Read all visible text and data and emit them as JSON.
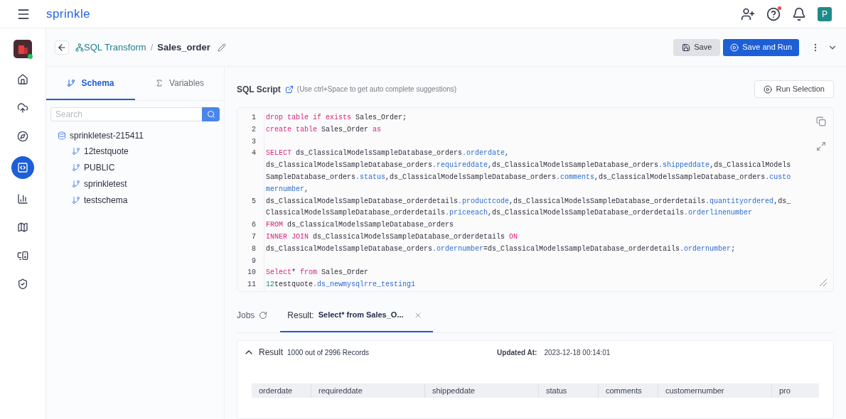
{
  "app": {
    "logo": "sprinkle",
    "avatar": "P",
    "help_notification": true
  },
  "rail": [
    {
      "selected": false
    },
    {
      "selected": false
    },
    {
      "selected": false
    },
    {
      "selected": true
    },
    {
      "selected": false
    },
    {
      "selected": false
    },
    {
      "selected": false
    },
    {
      "selected": false
    }
  ],
  "breadcrumb": {
    "parent": "SQL Transform",
    "separator": "/",
    "current": "Sales_order"
  },
  "actions": {
    "save": "Save",
    "save_and_run": "Save and Run"
  },
  "side_tabs": [
    {
      "label": "Schema",
      "selected": true
    },
    {
      "label": "Variables",
      "selected": false
    }
  ],
  "search": {
    "placeholder": "Search"
  },
  "schema_tree": [
    {
      "label": "sprinkletest-215411",
      "children": [
        {
          "label": "12testquote"
        },
        {
          "label": "PUBLIC"
        },
        {
          "label": "sprinkletest"
        },
        {
          "label": "testschema"
        }
      ]
    }
  ],
  "editor": {
    "title": "SQL Script",
    "hint": "(Use ctrl+Space to get auto complete suggestions)",
    "run_selection": "Run Selection",
    "lines": [
      {
        "number": "1",
        "tokens": [
          {
            "kind": "kw",
            "text": "drop table if exists"
          },
          {
            "kind": "plain",
            "text": " Sales_Order;"
          }
        ]
      },
      {
        "number": "2",
        "tokens": [
          {
            "kind": "kw",
            "text": "create table"
          },
          {
            "kind": "plain",
            "text": " Sales_Order "
          },
          {
            "kind": "kw",
            "text": "as"
          }
        ]
      },
      {
        "number": "3"
      },
      {
        "number": "4",
        "tokens": [
          {
            "kind": "kw",
            "text": "SELECT"
          },
          {
            "kind": "plain",
            "text": " ds_ClassicalModelsSampleDatabase_orders"
          },
          {
            "kind": "prop",
            "text": ".orderdate"
          },
          {
            "kind": "plain",
            "text": ", ds_ClassicalModelsSampleDatabase_orders"
          },
          {
            "kind": "prop",
            "text": ".requireddate"
          },
          {
            "kind": "plain",
            "text": ",ds_ClassicalModelsSampleDatabase_orders"
          },
          {
            "kind": "prop",
            "text": ".shippeddate"
          },
          {
            "kind": "plain",
            "text": ",ds_ClassicalModelsSampleDatabase_orders"
          },
          {
            "kind": "prop",
            "text": ".status"
          },
          {
            "kind": "plain",
            "text": ",ds_ClassicalModelsSampleDatabase_orders"
          },
          {
            "kind": "prop",
            "text": ".comments"
          },
          {
            "kind": "plain",
            "text": ",ds_ClassicalModelsSampleDatabase_orders"
          },
          {
            "kind": "prop",
            "text": ".customernumber"
          },
          {
            "kind": "plain",
            "text": ","
          }
        ]
      },
      {
        "number": "5",
        "tokens": [
          {
            "kind": "plain",
            "text": "ds_ClassicalModelsSampleDatabase_orderdetails"
          },
          {
            "kind": "prop",
            "text": ".productcode"
          },
          {
            "kind": "plain",
            "text": ",ds_ClassicalModelsSampleDatabase_orderdetails"
          },
          {
            "kind": "prop",
            "text": ".quantityordered"
          },
          {
            "kind": "plain",
            "text": ",ds_ClassicalModelsSampleDatabase_orderdetails"
          },
          {
            "kind": "prop",
            "text": ".priceeach"
          },
          {
            "kind": "plain",
            "text": ",ds_ClassicalModelsSampleDatabase_orderdetails"
          },
          {
            "kind": "prop",
            "text": ".orderlinenumber"
          }
        ]
      },
      {
        "number": "6",
        "tokens": [
          {
            "kind": "kw",
            "text": "FROM"
          },
          {
            "kind": "plain",
            "text": " ds_ClassicalModelsSampleDatabase_orders"
          }
        ]
      },
      {
        "number": "7",
        "tokens": [
          {
            "kind": "kw",
            "text": "INNER JOIN"
          },
          {
            "kind": "plain",
            "text": " ds_ClassicalModelsSampleDatabase_orderdetails "
          },
          {
            "kind": "kw",
            "text": "ON"
          }
        ]
      },
      {
        "number": "8",
        "tokens": [
          {
            "kind": "plain",
            "text": "ds_ClassicalModelsSampleDatabase_orders"
          },
          {
            "kind": "prop",
            "text": ".ordernumber"
          },
          {
            "kind": "plain",
            "text": "=ds_ClassicalModelsSampleDatabase_orderdetails"
          },
          {
            "kind": "prop",
            "text": ".ordernumber"
          },
          {
            "kind": "plain",
            "text": ";"
          }
        ]
      },
      {
        "number": "9"
      },
      {
        "number": "10",
        "tokens": [
          {
            "kind": "kw",
            "text": "Select"
          },
          {
            "kind": "plain",
            "text": "* "
          },
          {
            "kind": "kw",
            "text": "from"
          },
          {
            "kind": "plain",
            "text": " Sales_Order"
          }
        ]
      },
      {
        "number": "11",
        "tokens": [
          {
            "kind": "num",
            "text": "12"
          },
          {
            "kind": "plain",
            "text": "testquote"
          },
          {
            "kind": "prop",
            "text": ".ds_newmysqlrre_testing1"
          }
        ]
      }
    ]
  },
  "bottom_tabs": [
    {
      "label": "Jobs",
      "kind": "jobs",
      "selected": false
    },
    {
      "label": "Result:",
      "title": "Select* from Sales_O...",
      "kind": "result",
      "selected": true
    }
  ],
  "result": {
    "title": "Result",
    "count": "1000 out of 2996 Records",
    "updated_label": "Updated At:",
    "updated_value": "2023-12-18 00:14:01",
    "expanded": true,
    "columns": [
      "orderdate",
      "requireddate",
      "shippeddate",
      "status",
      "comments",
      "customernumber",
      "pro"
    ]
  }
}
